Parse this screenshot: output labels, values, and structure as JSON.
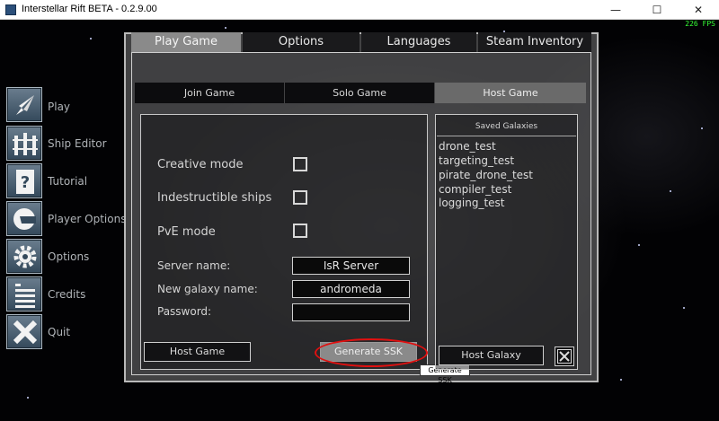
{
  "window": {
    "title": "Interstellar Rift BETA - 0.2.9.00",
    "minimize": "—",
    "maximize": "☐",
    "close": "✕"
  },
  "fps": "226 FPS",
  "sidebar": {
    "items": [
      {
        "label": "Play",
        "icon": "rocket-icon"
      },
      {
        "label": "Ship Editor",
        "icon": "ship-editor-icon"
      },
      {
        "label": "Tutorial",
        "icon": "tutorial-icon"
      },
      {
        "label": "Player Options",
        "icon": "helmet-icon"
      },
      {
        "label": "Options",
        "icon": "gear-icon"
      },
      {
        "label": "Credits",
        "icon": "credits-icon"
      },
      {
        "label": "Quit",
        "icon": "close-icon"
      }
    ]
  },
  "tabs": [
    "Play Game",
    "Options",
    "Languages",
    "Steam Inventory"
  ],
  "active_tab": "Play Game",
  "subtabs": [
    "Join Game",
    "Solo Game",
    "Host Game"
  ],
  "active_subtab": "Host Game",
  "host": {
    "options": [
      {
        "label": "Creative mode",
        "checked": false
      },
      {
        "label": "Indestructible ships",
        "checked": false
      },
      {
        "label": "PvE mode",
        "checked": false
      }
    ],
    "server_name_label": "Server name:",
    "server_name_value": "IsR Server",
    "galaxy_name_label": "New galaxy name:",
    "galaxy_name_value": "andromeda",
    "password_label": "Password:",
    "password_value": "",
    "host_button": "Host Game",
    "ssk_button": "Generate SSK",
    "ssk_tooltip": "Generate SSK"
  },
  "galaxies": {
    "title": "Saved Galaxies",
    "items": [
      "drone_test",
      "targeting_test",
      "pirate_drone_test",
      "compiler_test",
      "logging_test"
    ],
    "host_button": "Host Galaxy",
    "delete_icon": "close-icon"
  },
  "colors": {
    "highlight": "#e01010",
    "fps": "#36ff36",
    "active_tab": "#8a8a8a"
  }
}
